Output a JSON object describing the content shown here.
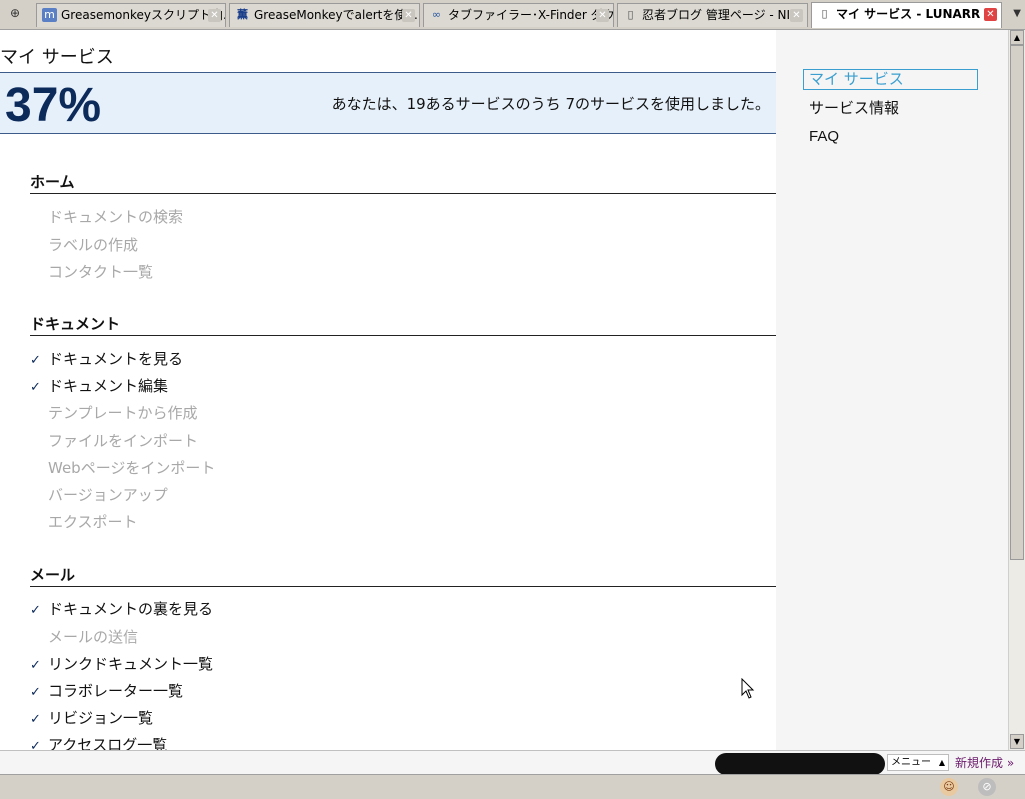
{
  "tabs": [
    {
      "label": "Greasemonkeyスクリプト内...",
      "icon": "m"
    },
    {
      "label": "GreaseMonkeyでalertを使...",
      "icon": "薫"
    },
    {
      "label": "タブファイラー･X-Finder ダウ...",
      "icon": "∞"
    },
    {
      "label": "忍者ブログ 管理ページ - NI...",
      "icon": "▯"
    },
    {
      "label": "マイ サービス - LUNARR",
      "icon": "▯"
    }
  ],
  "page": {
    "title": "マイ サービス",
    "percent": "37%",
    "summary": "あなたは、19あるサービスのうち 7のサービスを使用しました。"
  },
  "sidebar": {
    "links": [
      "マイ サービス",
      "サービス情報",
      "FAQ"
    ]
  },
  "sections": [
    {
      "heading": "ホーム",
      "items": [
        {
          "label": "ドキュメントの検索",
          "checked": false
        },
        {
          "label": "ラベルの作成",
          "checked": false
        },
        {
          "label": "コンタクト一覧",
          "checked": false
        }
      ]
    },
    {
      "heading": "ドキュメント",
      "items": [
        {
          "label": "ドキュメントを見る",
          "checked": true
        },
        {
          "label": "ドキュメント編集",
          "checked": true
        },
        {
          "label": "テンプレートから作成",
          "checked": false
        },
        {
          "label": "ファイルをインポート",
          "checked": false
        },
        {
          "label": "Webページをインポート",
          "checked": false
        },
        {
          "label": "バージョンアップ",
          "checked": false
        },
        {
          "label": "エクスポート",
          "checked": false
        }
      ]
    },
    {
      "heading": "メール",
      "items": [
        {
          "label": "ドキュメントの裏を見る",
          "checked": true
        },
        {
          "label": "メールの送信",
          "checked": false
        },
        {
          "label": "リンクドキュメント一覧",
          "checked": true
        },
        {
          "label": "コラボレーター一覧",
          "checked": true
        },
        {
          "label": "リビジョン一覧",
          "checked": true
        },
        {
          "label": "アクセスログ一覧",
          "checked": true
        }
      ]
    }
  ],
  "checkmark": "✓",
  "toolbar": {
    "menu_label": "メニュー",
    "new_label": "新規作成 »"
  }
}
